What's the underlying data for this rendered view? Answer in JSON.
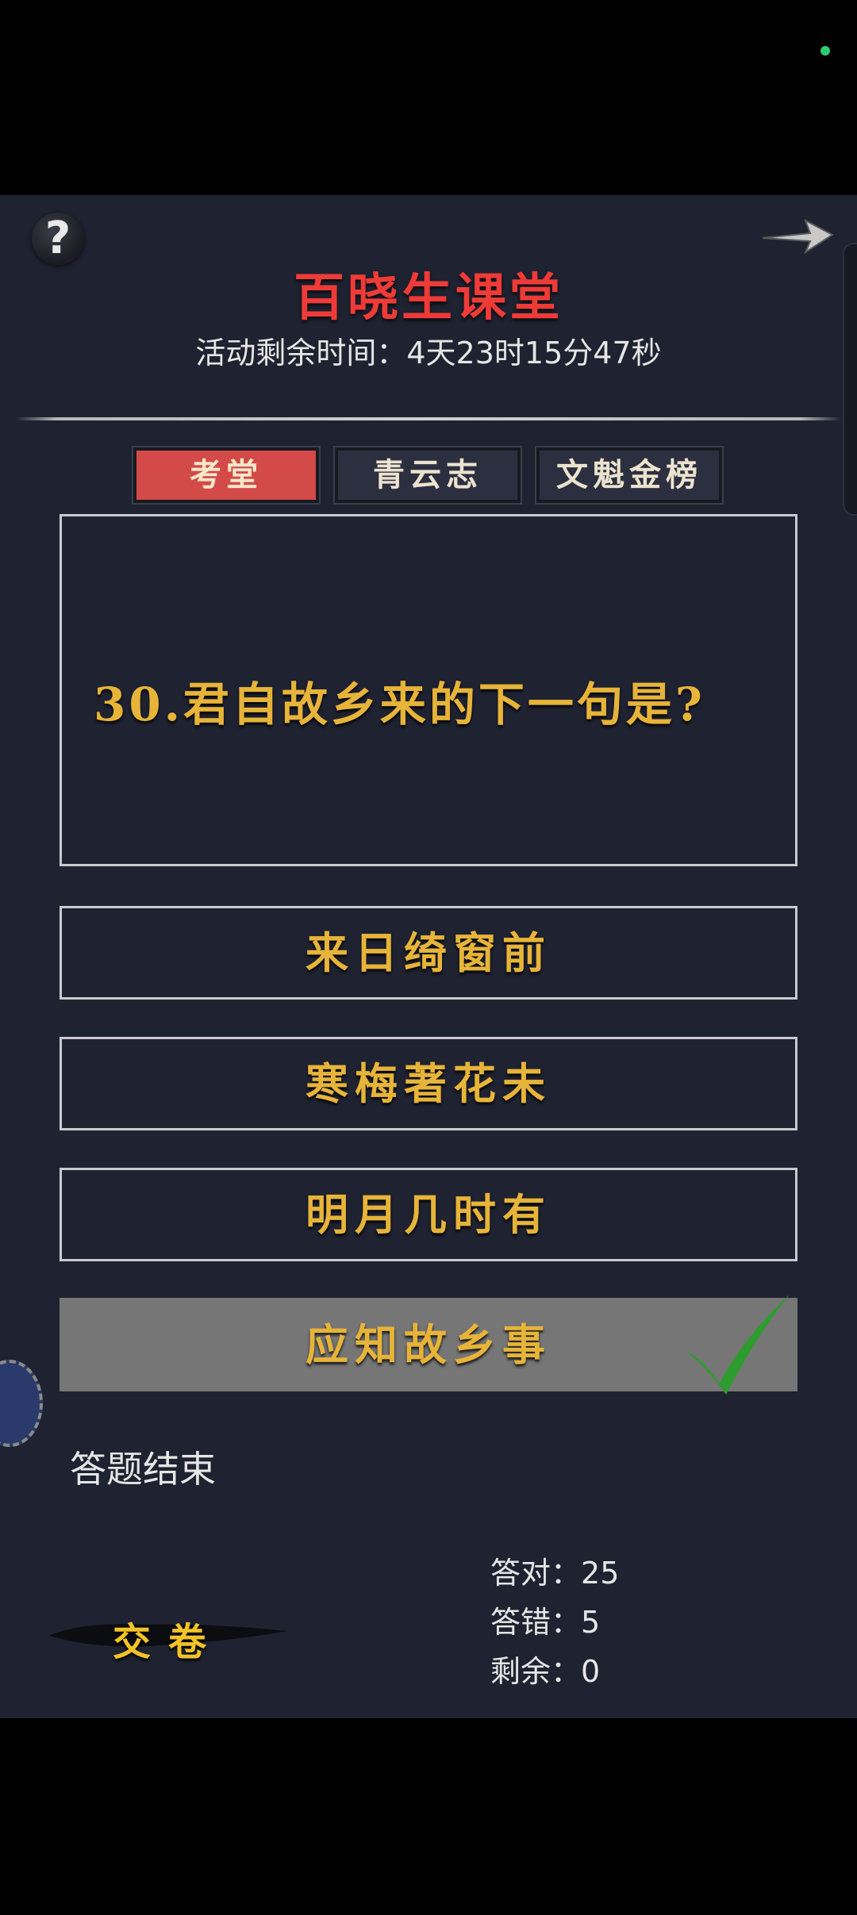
{
  "header": {
    "title": "百晓生课堂",
    "timer_label": "活动剩余时间：",
    "timer_value": "4天23时15分47秒",
    "help_icon": "question-mark-icon",
    "next_icon": "arrow-right-icon"
  },
  "tabs": [
    {
      "label": "考堂",
      "active": true
    },
    {
      "label": "青云志",
      "active": false
    },
    {
      "label": "文魁金榜",
      "active": false
    }
  ],
  "question": {
    "text": "30.君自故乡来的下一句是?"
  },
  "options": [
    {
      "label": "来日绮窗前",
      "correct": false
    },
    {
      "label": "寒梅著花未",
      "correct": false
    },
    {
      "label": "明月几时有",
      "correct": false
    },
    {
      "label": "应知故乡事",
      "correct": true
    }
  ],
  "status": {
    "end_text": "答题结束"
  },
  "submit": {
    "label": "交卷"
  },
  "stats": {
    "correct_label": "答对：",
    "correct_value": "25",
    "wrong_label": "答错：",
    "wrong_value": "5",
    "remaining_label": "剩余：",
    "remaining_value": "0"
  },
  "colors": {
    "title": "#ee3b37",
    "gold_text": "#e7b43a",
    "panel_bg": "#1f2230",
    "active_tab": "#d44a49",
    "correct_bg": "#767676",
    "checkmark": "#2e9b2e"
  }
}
